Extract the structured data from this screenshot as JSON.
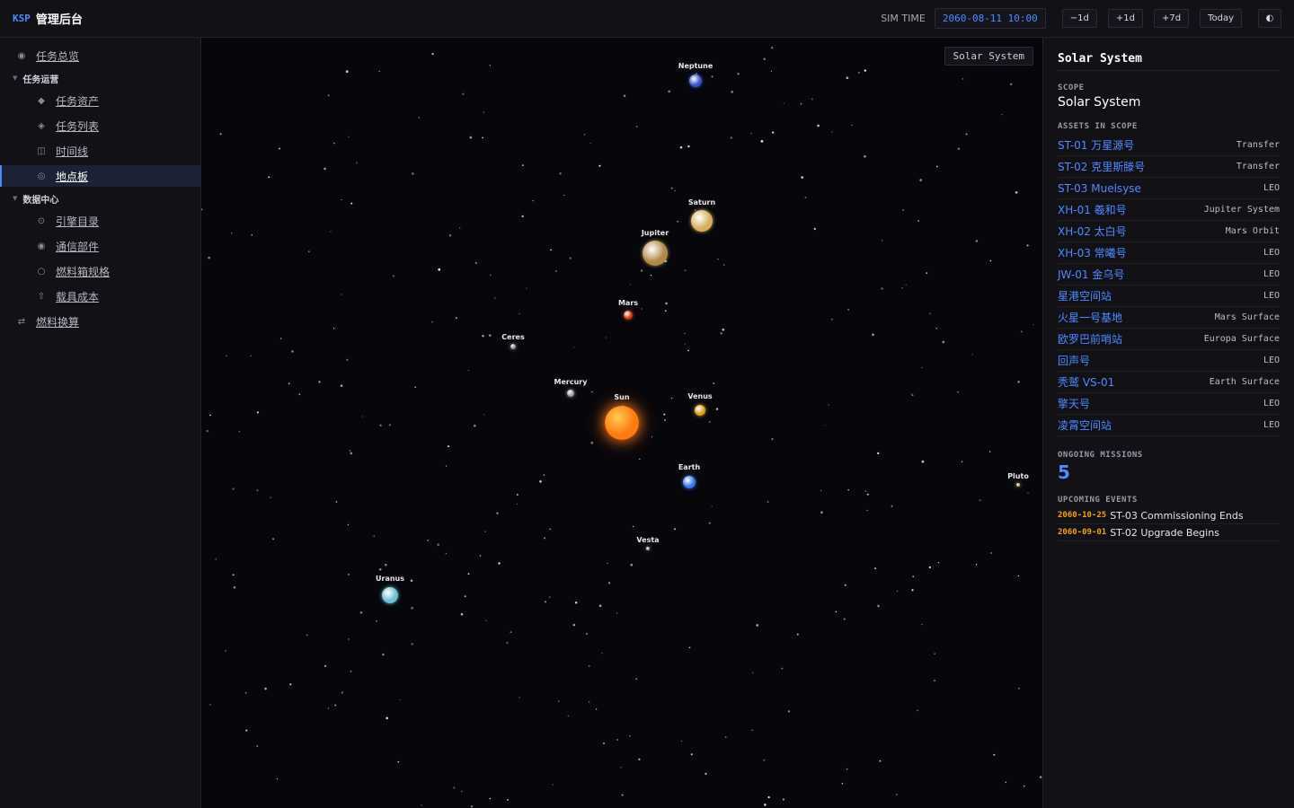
{
  "header": {
    "brand_code": "KSP",
    "brand_title": "管理后台",
    "sim_time_label": "SIM TIME",
    "sim_time_value": "2060-08-11 10:00",
    "buttons": [
      "−1d",
      "+1d",
      "+7d",
      "Today"
    ],
    "theme_icon": "◐"
  },
  "sidebar": {
    "items": [
      {
        "id": "overview",
        "label": "任务总览",
        "icon": "◉"
      },
      {
        "id": "ops-group",
        "label": "任务运营",
        "group": true
      },
      {
        "id": "assets",
        "label": "任务资产",
        "icon": "◆"
      },
      {
        "id": "missions",
        "label": "任务列表",
        "icon": "◈"
      },
      {
        "id": "timeline",
        "label": "时间线",
        "icon": "◫"
      },
      {
        "id": "locations",
        "label": "地点板",
        "icon": "◎",
        "active": true
      },
      {
        "id": "data-group",
        "label": "数据中心",
        "group": true
      },
      {
        "id": "engines",
        "label": "引擎目录",
        "icon": "⊙"
      },
      {
        "id": "comms",
        "label": "通信部件",
        "icon": "◉"
      },
      {
        "id": "tanks",
        "label": "燃料箱规格",
        "icon": "○"
      },
      {
        "id": "cost",
        "label": "载具成本",
        "icon": "⇧"
      },
      {
        "id": "fuel",
        "label": "燃料换算",
        "icon": "⇄"
      }
    ]
  },
  "map": {
    "scope_tag": "Solar System",
    "bodies": [
      {
        "name": "Sun",
        "color": "#ff7a10",
        "glow": "#ffcc55"
      },
      {
        "name": "Mercury",
        "color": "#9a9a9a"
      },
      {
        "name": "Venus",
        "color": "#d8a020"
      },
      {
        "name": "Earth",
        "color": "#3a78e8"
      },
      {
        "name": "Mars",
        "color": "#c83a18"
      },
      {
        "name": "Jupiter",
        "color": "#b08a4a"
      },
      {
        "name": "Saturn",
        "color": "#d6b060"
      },
      {
        "name": "Uranus",
        "color": "#6ec0d0"
      },
      {
        "name": "Neptune",
        "color": "#3a52c8"
      },
      {
        "name": "Pluto",
        "color": "#c8a888"
      },
      {
        "name": "Ceres",
        "color": "#8c8c8c"
      },
      {
        "name": "Vesta",
        "color": "#9a9a9a"
      }
    ]
  },
  "panel": {
    "title": "Solar System",
    "scope_label": "SCOPE",
    "scope_value": "Solar System",
    "assets_label": "ASSETS IN SCOPE",
    "assets": [
      {
        "name": "ST-01 万星源号",
        "loc": "Transfer"
      },
      {
        "name": "ST-02 克里斯滕号",
        "loc": "Transfer"
      },
      {
        "name": "ST-03 Muelsyse",
        "loc": "LEO"
      },
      {
        "name": "XH-01 羲和号",
        "loc": "Jupiter System"
      },
      {
        "name": "XH-02 太白号",
        "loc": "Mars Orbit"
      },
      {
        "name": "XH-03 常曦号",
        "loc": "LEO"
      },
      {
        "name": "JW-01 金乌号",
        "loc": "LEO"
      },
      {
        "name": "星港空间站",
        "loc": "LEO"
      },
      {
        "name": "火星一号基地",
        "loc": "Mars Surface"
      },
      {
        "name": "欧罗巴前哨站",
        "loc": "Europa Surface"
      },
      {
        "name": "回声号",
        "loc": "LEO"
      },
      {
        "name": "秃鹫 VS-01",
        "loc": "Earth Surface"
      },
      {
        "name": "擎天号",
        "loc": "LEO"
      },
      {
        "name": "凌霄空间站",
        "loc": "LEO"
      }
    ],
    "missions_label": "ONGOING MISSIONS",
    "missions_count": "5",
    "events_label": "UPCOMING EVENTS",
    "events": [
      {
        "date": "2060-10-25",
        "text": "ST-03 Commissioning Ends"
      },
      {
        "date": "2060-09-01",
        "text": "ST-02 Upgrade Begins"
      }
    ]
  }
}
